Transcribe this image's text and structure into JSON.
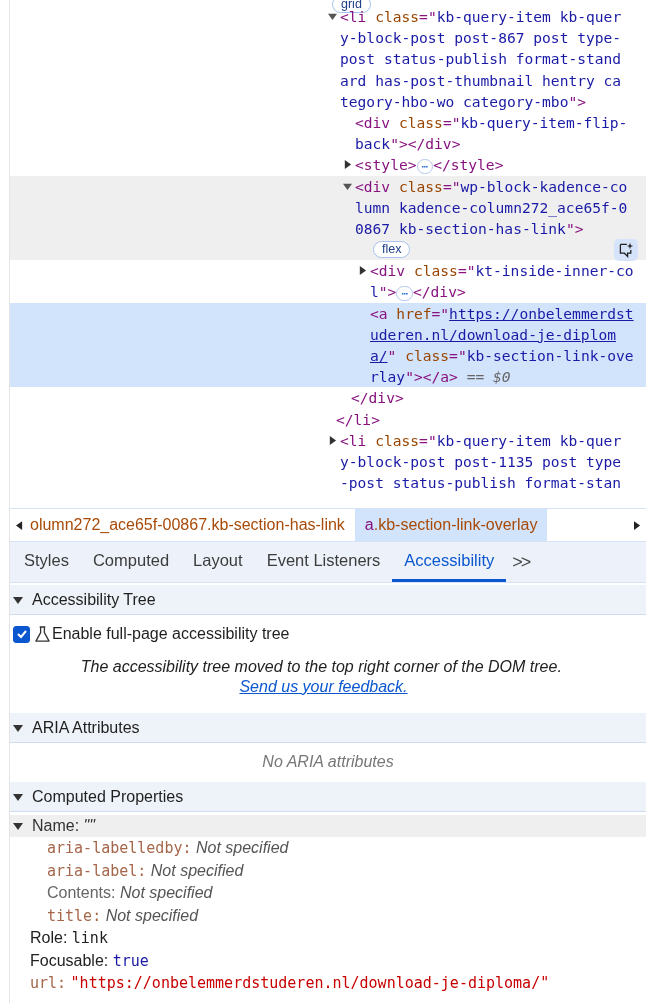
{
  "dom_tree": {
    "top_badge": "grid",
    "nodes": [
      {
        "expanded": true,
        "selected": false,
        "hovered": false,
        "open": [
          {
            "kind": "tag",
            "text": "<li "
          },
          {
            "kind": "attr",
            "text": "class"
          },
          {
            "kind": "tag",
            "text": "=\""
          },
          {
            "kind": "value",
            "text": "kb-query-item kb-query-block-post post-867 post type-post status-publish format-standard has-post-thumbnail hentry category-hbo-wo category-mbo"
          },
          {
            "kind": "tag",
            "text": "\">"
          }
        ],
        "children": [
          {
            "selected": false,
            "hovered": false,
            "open": [
              {
                "kind": "tag",
                "text": "<div "
              },
              {
                "kind": "attr",
                "text": "class"
              },
              {
                "kind": "tag",
                "text": "=\""
              },
              {
                "kind": "value",
                "text": "kb-query-item-flip-back"
              },
              {
                "kind": "tag",
                "text": "\"></div>"
              }
            ]
          },
          {
            "expanded": false,
            "selected": false,
            "hovered": false,
            "open": [
              {
                "kind": "tag",
                "text": "<style>"
              },
              {
                "kind": "ellipsis",
                "text": "⋯"
              },
              {
                "kind": "tag",
                "text": "</style>"
              }
            ]
          },
          {
            "expanded": true,
            "selected": false,
            "hovered": true,
            "badge": "flex",
            "open": [
              {
                "kind": "tag",
                "text": "<div "
              },
              {
                "kind": "attr",
                "text": "class"
              },
              {
                "kind": "tag",
                "text": "=\""
              },
              {
                "kind": "value",
                "text": "wp-block-kadence-column kadence-column272_ace65f-00867 kb-section-has-link"
              },
              {
                "kind": "tag",
                "text": "\">"
              }
            ],
            "children": [
              {
                "expanded": false,
                "selected": false,
                "hovered": false,
                "open": [
                  {
                    "kind": "tag",
                    "text": "<div "
                  },
                  {
                    "kind": "attr",
                    "text": "class"
                  },
                  {
                    "kind": "tag",
                    "text": "=\""
                  },
                  {
                    "kind": "value",
                    "text": "kt-inside-inner-col"
                  },
                  {
                    "kind": "tag",
                    "text": "\">"
                  },
                  {
                    "kind": "ellipsis",
                    "text": "⋯"
                  },
                  {
                    "kind": "tag",
                    "text": "</div>"
                  }
                ]
              },
              {
                "selected": true,
                "hovered": false,
                "open": [
                  {
                    "kind": "tag",
                    "text": "<a "
                  },
                  {
                    "kind": "attr",
                    "text": "href"
                  },
                  {
                    "kind": "tag",
                    "text": "=\""
                  },
                  {
                    "kind": "link",
                    "text": "https://onbelemmerdstuderen.nl/download-je-diploma/"
                  },
                  {
                    "kind": "tag",
                    "text": "\" "
                  },
                  {
                    "kind": "attr",
                    "text": "class"
                  },
                  {
                    "kind": "tag",
                    "text": "=\""
                  },
                  {
                    "kind": "value",
                    "text": "kb-section-link-overlay"
                  },
                  {
                    "kind": "tag",
                    "text": "\"></a>"
                  },
                  {
                    "kind": "comment",
                    "text": " == "
                  },
                  {
                    "kind": "variable",
                    "text": "$0"
                  }
                ]
              }
            ],
            "close": "</div>"
          }
        ],
        "close": "</li>"
      },
      {
        "expanded": false,
        "selected": false,
        "hovered": false,
        "open": [
          {
            "kind": "tag",
            "text": "<li "
          },
          {
            "kind": "attr",
            "text": "class"
          },
          {
            "kind": "tag",
            "text": "=\""
          },
          {
            "kind": "value",
            "text": "kb-query-item kb-query-block-post post-1135 post type-post status-publish format-stan"
          }
        ]
      }
    ]
  },
  "breadcrumbs": [
    {
      "rest": "olumn272_ace65f-00867.kb-section-has-link",
      "selected": false
    },
    {
      "tag": "a",
      "rest": ".kb-section-link-overlay",
      "selected": true
    }
  ],
  "tabs": [
    {
      "label": "Styles",
      "selected": false
    },
    {
      "label": "Computed",
      "selected": false
    },
    {
      "label": "Layout",
      "selected": false
    },
    {
      "label": "Event Listeners",
      "selected": false
    },
    {
      "label": "Accessibility",
      "selected": true
    }
  ],
  "more_tabs": ">>",
  "sections": [
    {
      "kind": "tree",
      "title": "Accessibility Tree",
      "expanded": true,
      "checkbox": {
        "label": "Enable full-page accessibility tree",
        "checked": true
      },
      "notice": "The accessibility tree moved to the top right corner of the DOM tree.",
      "notice_link": "Send us your feedback."
    },
    {
      "kind": "aria",
      "title": "ARIA Attributes",
      "expanded": true,
      "empty": "No ARIA attributes"
    },
    {
      "kind": "computed",
      "title": "Computed Properties",
      "expanded": true,
      "name": {
        "label": "Name:",
        "value": "\"\"",
        "expanded": true,
        "sources": [
          {
            "kind": "attr",
            "key": "aria-labelledby:",
            "value": "Not specified"
          },
          {
            "kind": "attr",
            "key": "aria-label:",
            "value": "Not specified"
          },
          {
            "kind": "plain",
            "key": "Contents:",
            "value": "Not specified"
          },
          {
            "kind": "attr",
            "key": "title:",
            "value": "Not specified"
          }
        ]
      },
      "properties": [
        {
          "kind": "text",
          "key": "Role:",
          "value": "link"
        },
        {
          "kind": "bool",
          "key": "Focusable:",
          "value": "true"
        },
        {
          "kind": "string",
          "key": "url:",
          "value": "\"https://onbelemmerdstuderen.nl/download-je-diploma/\""
        }
      ]
    }
  ]
}
